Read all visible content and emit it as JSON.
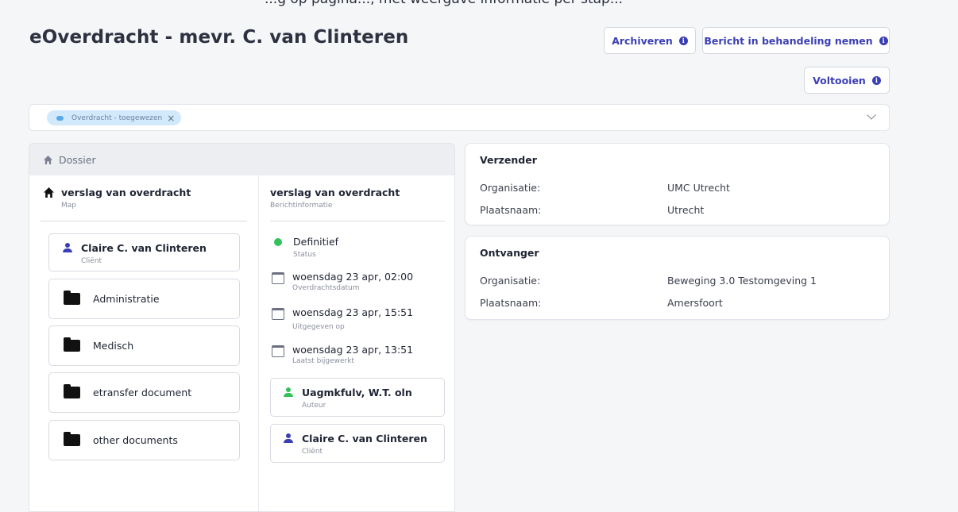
{
  "top_cut_text": "...g op pagina..., met weergave informatie per stap...",
  "page_title": "eOverdracht - mevr. C. van Clinteren",
  "actions": {
    "archive": "Archiveren",
    "take": "Bericht in behandeling nemen",
    "complete": "Voltooien",
    "info_glyph": "i"
  },
  "tags": {
    "active": "Overdracht - toegewezen",
    "remove_glyph": "×"
  },
  "dossier": {
    "header": "Dossier",
    "folder": {
      "title": "verslag van overdracht",
      "subtitle": "Map"
    },
    "client": {
      "name": "Claire C. van Clinteren",
      "role": "Cliënt"
    },
    "folders": [
      "Administratie",
      "Medisch",
      "etransfer document",
      "other documents"
    ],
    "message": {
      "title": "verslag van overdracht",
      "subtitle": "Berichtinformatie",
      "status_value": "Definitief",
      "status_label": "Status",
      "dates": [
        {
          "value": "woensdag 23 apr, 02:00",
          "label": "Overdrachtsdatum"
        },
        {
          "value": "woensdag 23 apr, 15:51",
          "label": "Uitgegeven op"
        },
        {
          "value": "woensdag 23 apr, 13:51",
          "label": "Laatst bijgewerkt"
        }
      ],
      "author": {
        "name": "Uagmkfulv, W.T. oln",
        "role": "Auteur"
      },
      "client": {
        "name": "Claire C. van Clinteren",
        "role": "Cliënt"
      }
    }
  },
  "sender": {
    "title": "Verzender",
    "org_label": "Organisatie:",
    "org_value": "UMC Utrecht",
    "city_label": "Plaatsnaam:",
    "city_value": "Utrecht"
  },
  "receiver": {
    "title": "Ontvanger",
    "org_label": "Organisatie:",
    "org_value": "Beweging 3.0 Testomgeving 1",
    "city_label": "Plaatsnaam:",
    "city_value": "Amersfoort"
  },
  "colors": {
    "accent": "#3b3fb6",
    "status_green": "#34c15c",
    "tag_bg": "#d2e8fb"
  }
}
